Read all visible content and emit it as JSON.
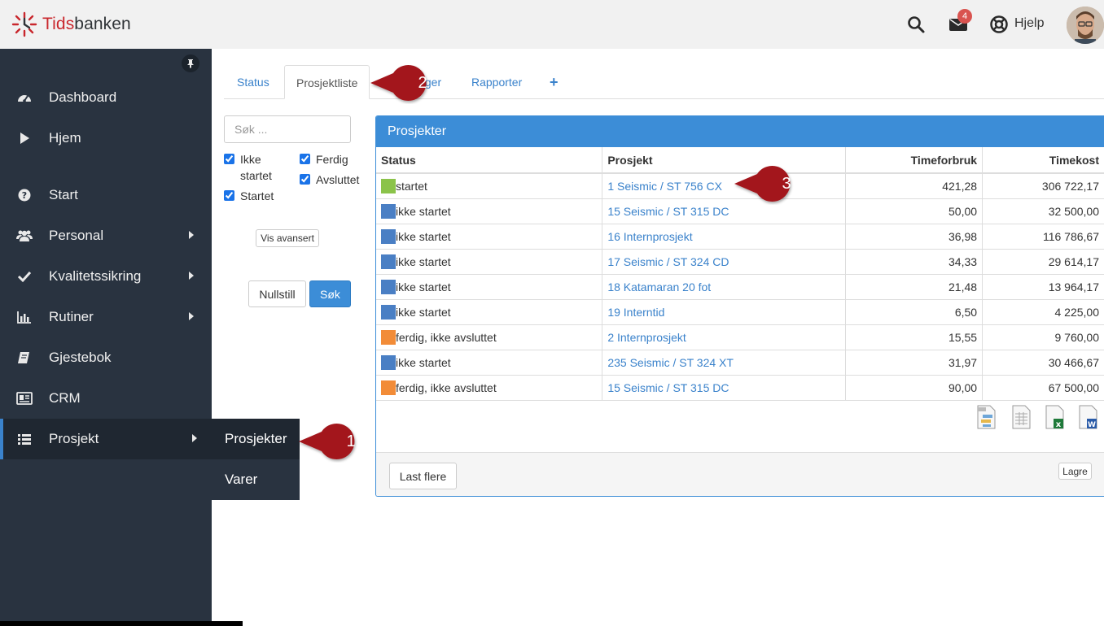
{
  "app": {
    "brand_a": "Tids",
    "brand_b": "banken"
  },
  "header": {
    "notifications_count": "4",
    "help_label": "Hjelp",
    "icons": [
      "search-icon",
      "envelope-icon",
      "lifebuoy-icon"
    ]
  },
  "sidebar": {
    "items": [
      {
        "label": "Dashboard",
        "icon": "dashboard-icon"
      },
      {
        "label": "Hjem",
        "icon": "play-icon"
      },
      {
        "label": "Start",
        "icon": "question-icon"
      },
      {
        "label": "Personal",
        "icon": "users-icon"
      },
      {
        "label": "Kvalitetssikring",
        "icon": "check-icon"
      },
      {
        "label": "Rutiner",
        "icon": "bar-chart-icon"
      },
      {
        "label": "Gjestebok",
        "icon": "book-icon"
      },
      {
        "label": "CRM",
        "icon": "id-card-icon"
      },
      {
        "label": "Prosjekt",
        "icon": "list-icon"
      }
    ],
    "submenu": [
      {
        "label": "Prosjekter"
      },
      {
        "label": "Varer"
      }
    ]
  },
  "tabs": [
    {
      "label": "Status"
    },
    {
      "label": "Prosjektliste"
    },
    {
      "label": "inger"
    },
    {
      "label": "Rapporter"
    },
    {
      "label": "+"
    }
  ],
  "filters": {
    "search_placeholder": "Søk ...",
    "checkboxes": [
      {
        "label": "Ikke startet",
        "checked": true
      },
      {
        "label": "Ferdig",
        "checked": true
      },
      {
        "label": "Avsluttet",
        "checked": true
      },
      {
        "label": "Startet",
        "checked": true
      }
    ],
    "advanced_label": "Vis avansert",
    "reset_label": "Nullstill",
    "search_label": "Søk"
  },
  "panel": {
    "title": "Prosjekter",
    "columns": [
      "Status",
      "Prosjekt",
      "Timeforbruk",
      "Timekost"
    ],
    "rows": [
      {
        "status": "startet",
        "color": "#8bc34a",
        "project": "1 Seismic / ST 756 CX",
        "hours": "421,28",
        "cost": "306 722,17"
      },
      {
        "status": "ikke startet",
        "color": "#4a7fc4",
        "project": "15 Seismic / ST 315 DC",
        "hours": "50,00",
        "cost": "32 500,00"
      },
      {
        "status": "ikke startet",
        "color": "#4a7fc4",
        "project": "16 Internprosjekt",
        "hours": "36,98",
        "cost": "116 786,67"
      },
      {
        "status": "ikke startet",
        "color": "#4a7fc4",
        "project": "17 Seismic / ST 324 CD",
        "hours": "34,33",
        "cost": "29 614,17"
      },
      {
        "status": "ikke startet",
        "color": "#4a7fc4",
        "project": "18 Katamaran 20 fot",
        "hours": "21,48",
        "cost": "13 964,17"
      },
      {
        "status": "ikke startet",
        "color": "#4a7fc4",
        "project": "19 Interntid",
        "hours": "6,50",
        "cost": "4 225,00"
      },
      {
        "status": "ferdig, ikke avsluttet",
        "color": "#f28c38",
        "project": "2 Internprosjekt",
        "hours": "15,55",
        "cost": "9 760,00"
      },
      {
        "status": "ikke startet",
        "color": "#4a7fc4",
        "project": "235 Seismic / ST 324 XT",
        "hours": "31,97",
        "cost": "30 466,67"
      },
      {
        "status": "ferdig, ikke avsluttet",
        "color": "#f28c38",
        "project": "15 Seismic / ST 315 DC",
        "hours": "90,00",
        "cost": "67 500,00"
      }
    ],
    "load_more_label": "Last flere",
    "save_label": "Lagre",
    "export_icons": [
      "pdf-export-icon",
      "print-export-icon",
      "excel-export-icon",
      "word-export-icon"
    ]
  },
  "callouts": [
    "1",
    "2",
    "3"
  ],
  "colors": {
    "accent": "#3c8dd7",
    "sidebar": "#293340",
    "callout": "#a3191f"
  }
}
